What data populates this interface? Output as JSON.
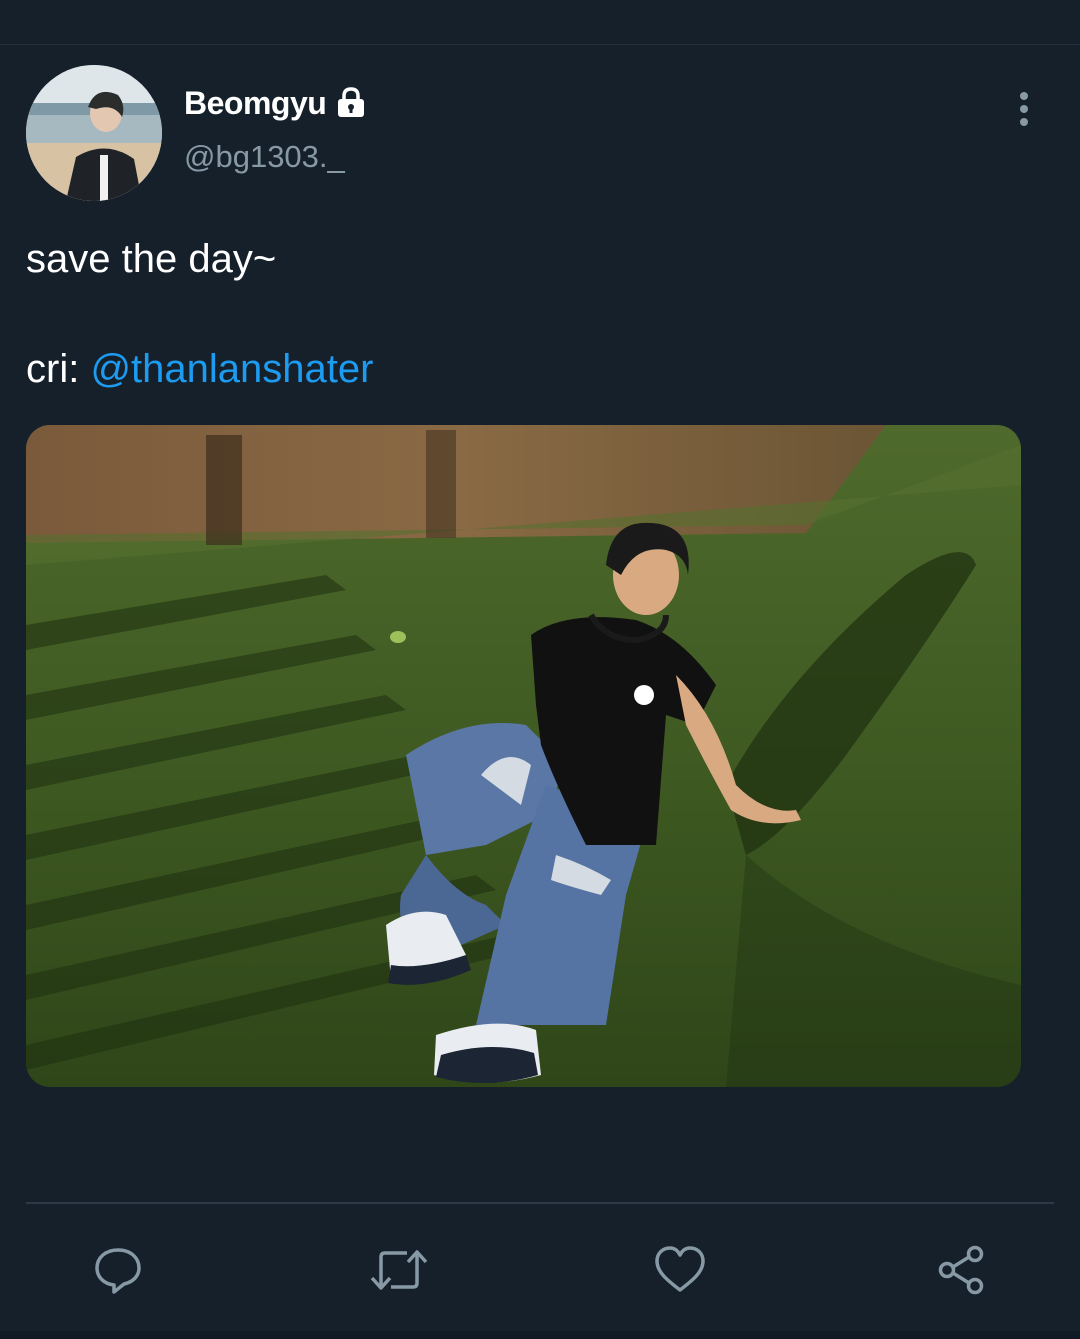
{
  "tweet": {
    "display_name": "Beomgyu",
    "handle": "@bg1303._",
    "text_line1": "save the day~",
    "text_line2_prefix": "cri: ",
    "mention": "@thanlanshater"
  },
  "icons": {
    "protected": "lock-icon",
    "more": "more-vertical-icon",
    "reply": "reply-icon",
    "retweet": "retweet-icon",
    "like": "heart-icon",
    "share": "share-icon"
  },
  "colors": {
    "background": "#15202b",
    "accent": "#1d9bf0",
    "secondary_text": "#8899a6",
    "icon": "#8899a6"
  }
}
